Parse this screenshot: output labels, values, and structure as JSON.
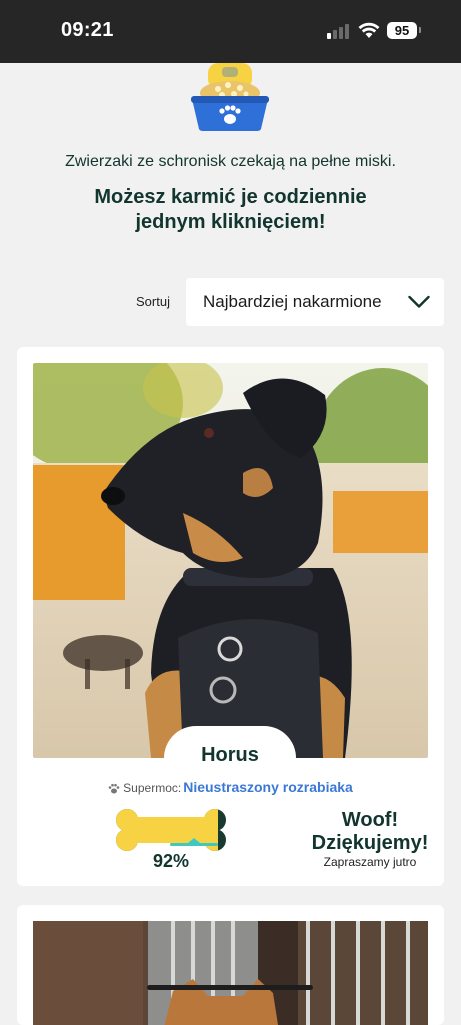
{
  "status_bar": {
    "time": "09:21",
    "battery": "95",
    "icons": [
      "signal-icon",
      "wifi-icon",
      "battery-icon"
    ]
  },
  "header": {
    "icon": "food-bowl-icon",
    "intro": "Zwierzaki ze schronisk czekają na pełne miski.",
    "headline_line1": "Możesz karmić je codziennie",
    "headline_line2": "jednym kliknięciem!"
  },
  "sort": {
    "label": "Sortuj",
    "selected": "Najbardziej nakarmione"
  },
  "pets": [
    {
      "name": "Horus",
      "superpower_label": "Supermoc:",
      "superpower": "Nieustraszony rozrabiaka",
      "fed_percent": 0.92,
      "fed_label": "92%",
      "thanks_line1": "Woof!",
      "thanks_line2": "Dziękujemy!",
      "thanks_sub": "Zapraszamy jutro"
    }
  ],
  "colors": {
    "brand_text": "#12352e",
    "bone_yellow": "#f7d343",
    "bone_dark": "#1a3a31",
    "link_blue": "#3b78d6",
    "bowl_blue": "#2f6fd8",
    "progress_teal": "#40c8c0"
  }
}
